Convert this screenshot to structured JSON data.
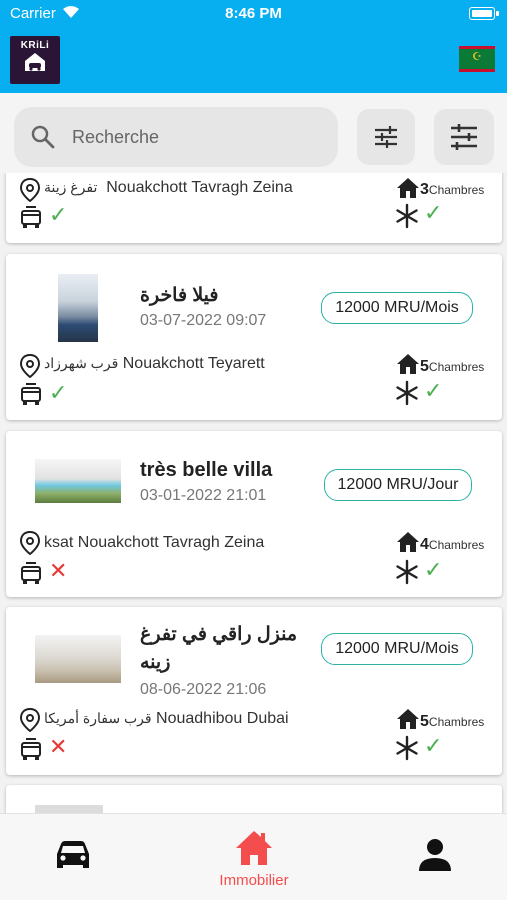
{
  "status_bar": {
    "carrier": "Carrier",
    "time": "8:46 PM"
  },
  "app_bar": {
    "logo_text": "KRiLi"
  },
  "search": {
    "placeholder": "Recherche"
  },
  "listings": [
    {
      "title": "",
      "date": "",
      "price": "",
      "location_ar": "تفرغ زينة",
      "location": "Nouakchott Tavragh Zeina",
      "rooms": "3",
      "rooms_label": "Chambres",
      "available": "✓",
      "ac": "✓"
    },
    {
      "title": "فيلا فاخرة",
      "date": "03-07-2022 09:07",
      "price": "12000 MRU/Mois",
      "location_ar": "قرب شهرزاد",
      "location": "Nouakchott Teyarett",
      "rooms": "5",
      "rooms_label": "Chambres",
      "available": "✓",
      "ac": "✓"
    },
    {
      "title": "très belle villa",
      "date": "03-01-2022 21:01",
      "price": "12000 MRU/Jour",
      "location_ar": "",
      "location": "ksat Nouakchott Tavragh Zeina",
      "rooms": "4",
      "rooms_label": "Chambres",
      "available": "✕",
      "ac": "✓"
    },
    {
      "title": "منزل راقي في تفرغ زينه",
      "date": "08-06-2022 21:06",
      "price": "12000 MRU/Mois",
      "location_ar": "قرب سفارة أمريكا",
      "location": "Nouadhibou Dubai",
      "rooms": "5",
      "rooms_label": "Chambres",
      "available": "✕",
      "ac": "✓"
    }
  ],
  "bottom_nav": {
    "active_label": "Immobilier"
  },
  "colors": {
    "primary": "#07aef0",
    "accent": "#f44d4d",
    "ok": "#4caf50",
    "no": "#e53935",
    "price_border": "#2bb3a6"
  }
}
